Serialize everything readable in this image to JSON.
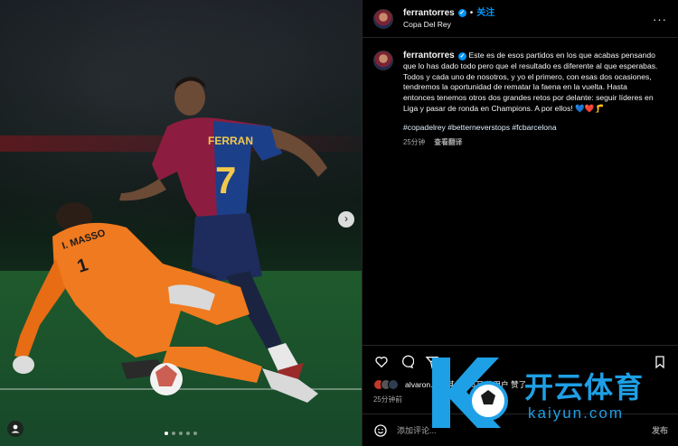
{
  "post": {
    "username": "ferrantorres",
    "follow_label": "关注",
    "separator": "•",
    "location": "Copa Del Rey",
    "more_icon": "more-icon",
    "carousel": {
      "slide_count": 5,
      "active_slide": 1
    }
  },
  "photo": {
    "jersey_name": "FERRAN",
    "jersey_number": "7",
    "keeper_name": "I. MASSO",
    "keeper_number": "1"
  },
  "caption": {
    "username": "ferrantorres",
    "text": "Este es de esos partidos en los que acabas pensando que lo has dado todo pero que el resultado es diferente al que esperabas. Todos y cada uno de nosotros, y yo el primero, con esas dos ocasiones, tendremos la oportunidad de rematar la faena en la vuelta. Hasta entonces tenemos otros dos grandes retos por delante: seguir líderes en Liga y pasar de ronda en Champions. A por ellos! 💙❤️🦵",
    "hashtags": "#copadelrey #betterneverstops #fcbarcelona",
    "time": "25分钟",
    "translate_label": "查看翻译"
  },
  "likes": {
    "text": "alvaron... 和其他 5.6万 位用户 赞了",
    "time_ago": "25分钟前"
  },
  "comment": {
    "placeholder": "添加评论...",
    "post_label": "发布"
  },
  "watermark": {
    "brand": "开云体育",
    "url": "kaiyun.com"
  },
  "colors": {
    "accent": "#0095f6",
    "background": "#000000",
    "secondary_text": "#a8a8a8",
    "barca_blue": "#1c3f8a",
    "barca_red": "#8c1d40",
    "keeper_orange": "#f07a1f"
  }
}
